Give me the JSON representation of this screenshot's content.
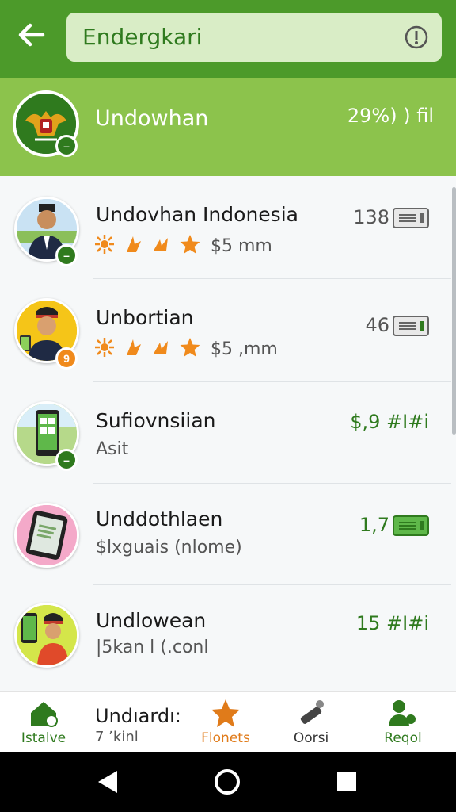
{
  "header": {
    "search_text": "Endergkari"
  },
  "featured": {
    "title": "Undowhan",
    "meta": "29%)  ) fil"
  },
  "list": {
    "rows": [
      {
        "title": "Undovhan Indonesia",
        "price": "$5 mm",
        "value": "138"
      },
      {
        "title": "Unbortian",
        "price": "$5 ,mm",
        "value": "46",
        "badge": "9"
      },
      {
        "title": "Sufiovnsiian",
        "subtitle": "Asit",
        "value": "$,9 #I#i"
      },
      {
        "title": "Unddothlaen",
        "subtitle": "$lxguais (nlome)",
        "value": "1,7"
      },
      {
        "title": "Undlowean",
        "subtitle": "|5kan l (.conl",
        "value": "15 #I#i"
      }
    ],
    "peek": {
      "title": "Undıardı:",
      "subtitle": "7 ʼkinl"
    }
  },
  "bottom_nav": [
    {
      "label": "Istalve",
      "color": "#2f7a1e"
    },
    {
      "label": "Flonets",
      "color": "#e07b1a"
    },
    {
      "label": "Oorsi",
      "color": "#333333"
    },
    {
      "label": "Reqol",
      "color": "#2f7a1e"
    }
  ],
  "colors": {
    "primary": "#4c9a2a",
    "featured": "#8cc34c",
    "accent_orange": "#f08a1c",
    "text_green": "#2f7a1e"
  }
}
